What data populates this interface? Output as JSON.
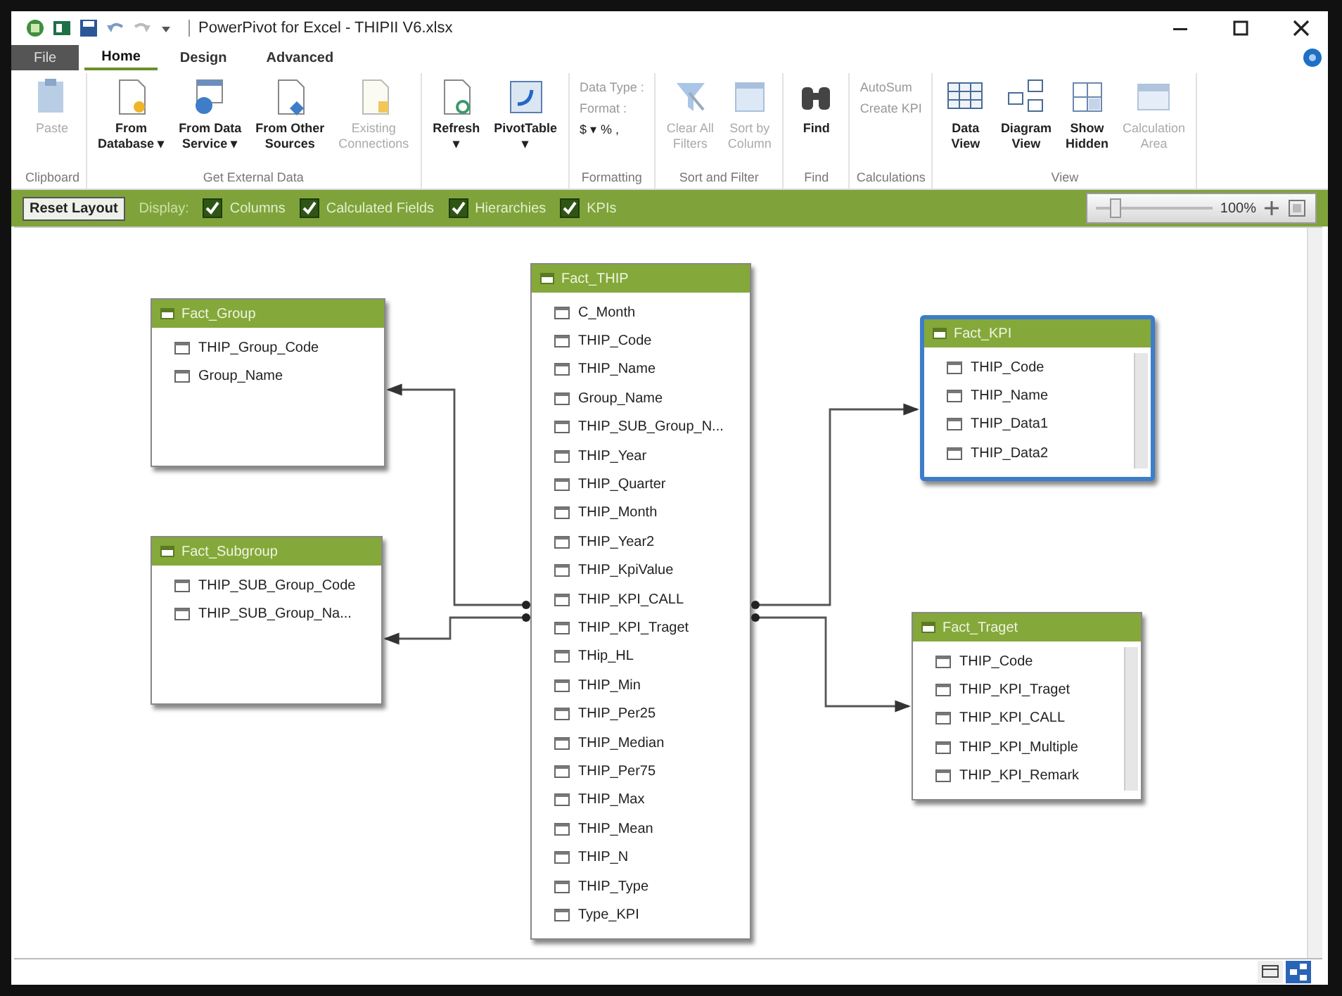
{
  "window": {
    "title": "PowerPivot for Excel - THIPII V6.xlsx"
  },
  "tabs": [
    {
      "label": "File",
      "kind": "file",
      "selected": false
    },
    {
      "label": "Home",
      "kind": "tab",
      "selected": true
    },
    {
      "label": "Design",
      "kind": "tab",
      "selected": false
    },
    {
      "label": "Advanced",
      "kind": "tab",
      "selected": false
    }
  ],
  "ribbon": {
    "groups": [
      {
        "label": "Clipboard",
        "buttons": [
          {
            "label": "Paste",
            "kind": "paste",
            "disabled": true
          }
        ]
      },
      {
        "label": "Get External Data",
        "buttons": [
          {
            "label": "From\nDatabase ▾",
            "kind": "database",
            "disabled": false
          },
          {
            "label": "From Data\nService ▾",
            "kind": "service",
            "disabled": false
          },
          {
            "label": "From Other\nSources",
            "kind": "sources",
            "disabled": false
          },
          {
            "label": "Existing\nConnections",
            "kind": "connections",
            "disabled": true
          }
        ]
      },
      {
        "buttons": [
          {
            "label": "Refresh\n▾",
            "kind": "refresh",
            "disabled": false
          },
          {
            "label": "PivotTable\n▾",
            "kind": "pivot",
            "disabled": false
          }
        ]
      },
      {
        "label": "Formatting",
        "buttons": [
          {
            "label": "Data Type :",
            "kind": "small",
            "disabled": true
          },
          {
            "label": "Format :",
            "kind": "small",
            "disabled": true
          },
          {
            "label": "$ ▾ % ,",
            "kind": "small",
            "disabled": false
          }
        ]
      },
      {
        "label": "Sort and Filter",
        "buttons": [
          {
            "label": "Clear All\nFilters",
            "kind": "filter",
            "disabled": true
          },
          {
            "label": "Sort by\nColumn",
            "kind": "sort",
            "disabled": true
          }
        ]
      },
      {
        "label": "Find",
        "buttons": [
          {
            "label": "Find",
            "kind": "find",
            "disabled": false
          }
        ]
      },
      {
        "label": "Calculations",
        "buttons": [
          {
            "label": "AutoSum",
            "kind": "small",
            "disabled": true
          },
          {
            "label": "Create KPI",
            "kind": "small",
            "disabled": true
          }
        ]
      },
      {
        "label": "View",
        "buttons": [
          {
            "label": "Data\nView",
            "kind": "dataview",
            "disabled": false
          },
          {
            "label": "Diagram\nView",
            "kind": "diagramview",
            "disabled": false
          },
          {
            "label": "Show\nHidden",
            "kind": "hidden",
            "disabled": false
          },
          {
            "label": "Calculation\nArea",
            "kind": "calcarea",
            "disabled": true
          }
        ]
      }
    ]
  },
  "display_bar": {
    "reset_button": "Reset Layout",
    "display_label": "Display:",
    "options": [
      {
        "label": "Columns",
        "checked": true
      },
      {
        "label": "Calculated Fields",
        "checked": true
      },
      {
        "label": "Hierarchies",
        "checked": true
      },
      {
        "label": "KPIs",
        "checked": true
      }
    ],
    "zoom": {
      "level": 0.12,
      "reading": "100%"
    }
  },
  "diagram": {
    "tables": [
      {
        "title": "Fact_Group",
        "selected": false,
        "columns": [
          "THIP_Group_Code",
          "Group_Name"
        ]
      },
      {
        "title": "Fact_Subgroup",
        "selected": false,
        "columns": [
          "THIP_SUB_Group_Code",
          "THIP_SUB_Group_Na..."
        ]
      },
      {
        "title": "Fact_THIP",
        "selected": false,
        "columns": [
          "C_Month",
          "THIP_Code",
          "THIP_Name",
          "Group_Name",
          "THIP_SUB_Group_N...",
          "THIP_Year",
          "THIP_Quarter",
          "THIP_Month",
          "THIP_Year2",
          "THIP_KpiValue",
          "THIP_KPI_CALL",
          "THIP_KPI_Traget",
          "THip_HL",
          "THIP_Min",
          "THIP_Per25",
          "THIP_Median",
          "THIP_Per75",
          "THIP_Max",
          "THIP_Mean",
          "THIP_N",
          "THIP_Type",
          "Type_KPI"
        ]
      },
      {
        "title": "Fact_KPI",
        "selected": true,
        "columns": [
          "THIP_Code",
          "THIP_Name",
          "THIP_Data1",
          "THIP_Data2"
        ]
      },
      {
        "title": "Fact_Traget",
        "selected": false,
        "columns": [
          "THIP_Code",
          "THIP_KPI_Traget",
          "THIP_KPI_CALL",
          "THIP_KPI_Multiple",
          "THIP_KPI_Remark"
        ]
      }
    ]
  },
  "status_bar": {
    "view_buttons": [
      {
        "kind": "grid",
        "selected": false
      },
      {
        "kind": "diagram",
        "selected": true
      }
    ]
  }
}
